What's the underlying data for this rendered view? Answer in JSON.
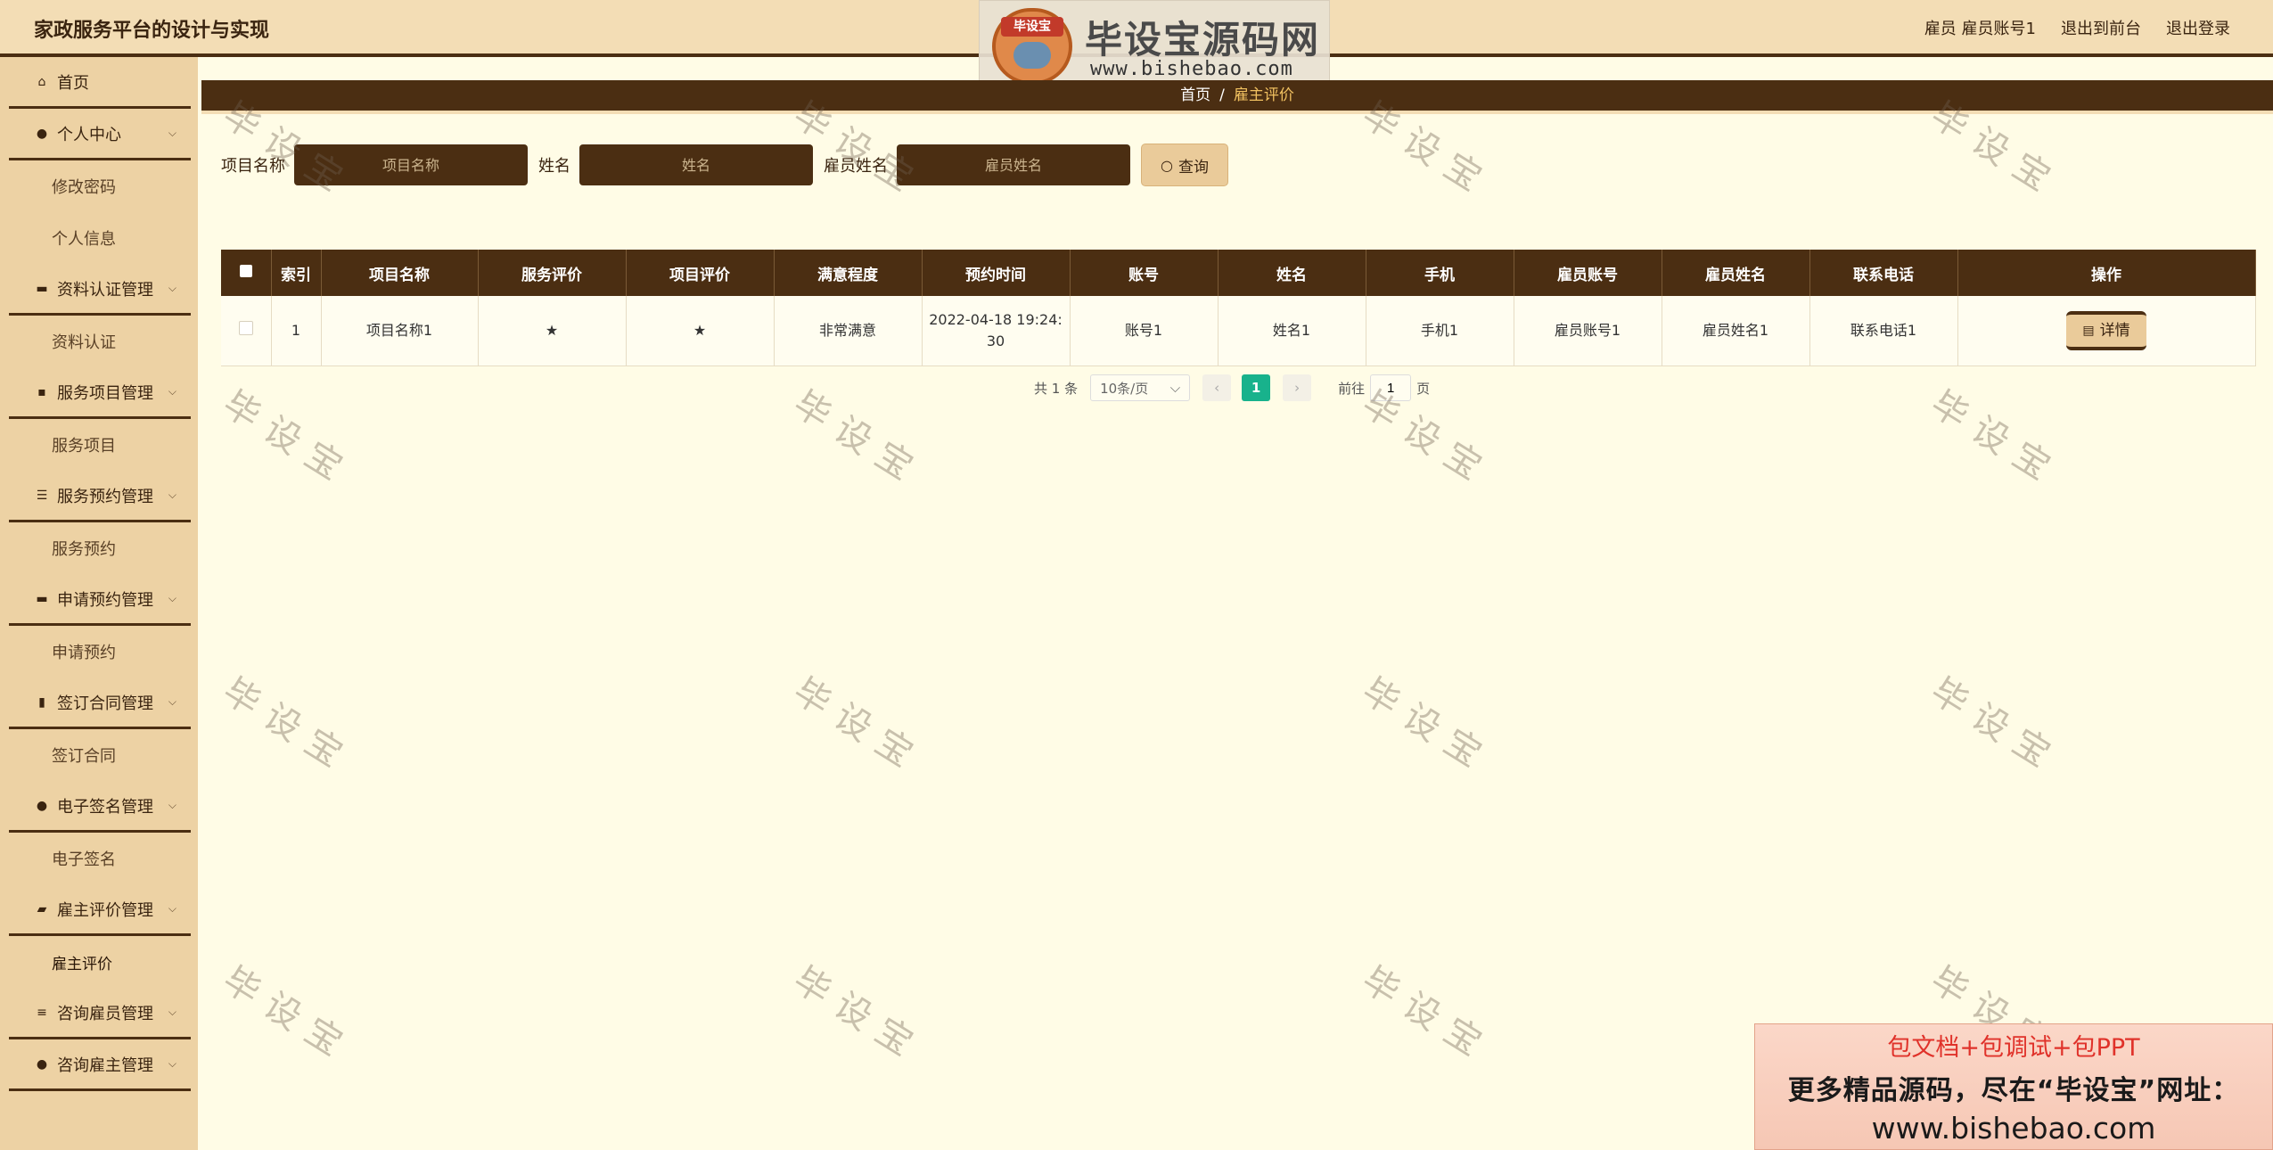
{
  "header": {
    "title": "家政服务平台的设计与实现",
    "user_label": "雇员 雇员账号1",
    "back_to_front": "退出到前台",
    "logout": "退出登录"
  },
  "logo": {
    "tag": "毕设宝",
    "name": "毕设宝源码网",
    "url": "www.bishebao.com"
  },
  "sidebar": {
    "home": "首页",
    "groups": [
      {
        "label": "个人中心",
        "icon": "user-icon",
        "subs": [
          "修改密码",
          "个人信息"
        ]
      },
      {
        "label": "资料认证管理",
        "icon": "monitor-icon",
        "subs": [
          "资料认证"
        ]
      },
      {
        "label": "服务项目管理",
        "icon": "chat-icon",
        "subs": [
          "服务项目"
        ]
      },
      {
        "label": "服务预约管理",
        "icon": "sliders-icon",
        "subs": [
          "服务预约"
        ]
      },
      {
        "label": "申请预约管理",
        "icon": "monitor-icon",
        "subs": [
          "申请预约"
        ]
      },
      {
        "label": "签订合同管理",
        "icon": "chart-icon",
        "subs": [
          "签订合同"
        ]
      },
      {
        "label": "电子签名管理",
        "icon": "bulb-icon",
        "subs": [
          "电子签名"
        ]
      },
      {
        "label": "雇主评价管理",
        "icon": "thumb-icon",
        "subs": [
          "雇主评价"
        ]
      },
      {
        "label": "咨询雇员管理",
        "icon": "list-icon",
        "subs": []
      },
      {
        "label": "咨询雇主管理",
        "icon": "user-icon",
        "subs": []
      }
    ]
  },
  "breadcrumb": {
    "home": "首页",
    "sep": "/",
    "current": "雇主评价"
  },
  "search": {
    "project_label": "项目名称",
    "project_placeholder": "项目名称",
    "name_label": "姓名",
    "name_placeholder": "姓名",
    "employee_label": "雇员姓名",
    "employee_placeholder": "雇员姓名",
    "button": "查询"
  },
  "table": {
    "headers": [
      "索引",
      "项目名称",
      "服务评价",
      "项目评价",
      "满意程度",
      "预约时间",
      "账号",
      "姓名",
      "手机",
      "雇员账号",
      "雇员姓名",
      "联系电话",
      "操作"
    ],
    "rows": [
      {
        "index": "1",
        "project": "项目名称1",
        "service_rating": "★",
        "project_rating": "★",
        "satisfaction": "非常满意",
        "time": "2022-04-18 19:24:30",
        "account": "账号1",
        "name": "姓名1",
        "phone": "手机1",
        "employee_account": "雇员账号1",
        "employee_name": "雇员姓名1",
        "contact": "联系电话1",
        "action": "详情"
      }
    ]
  },
  "pagination": {
    "total": "共 1 条",
    "page_size": "10条/页",
    "current": "1",
    "goto_label": "前往",
    "goto_value": "1",
    "page_suffix": "页"
  },
  "watermark": "毕设宝",
  "ad": {
    "line1": "包文档+包调试+包PPT",
    "line2": "更多精品源码，尽在“毕设宝”网址：",
    "line3": "www.bishebao.com"
  }
}
